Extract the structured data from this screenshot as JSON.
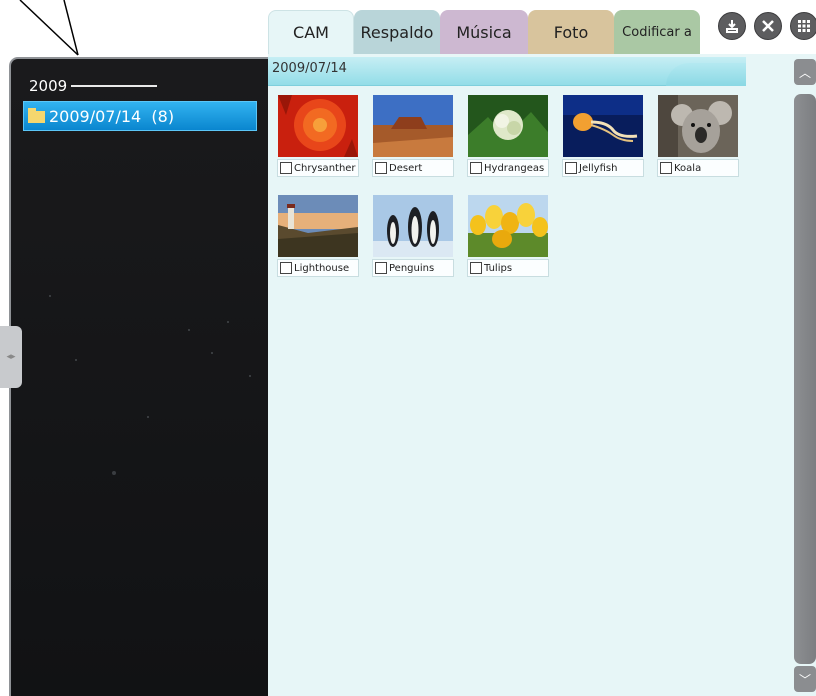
{
  "tree": {
    "year": "2009",
    "date_item": "2009/07/14  (8)"
  },
  "tabs": [
    {
      "label": "CAM"
    },
    {
      "label": "Respaldo"
    },
    {
      "label": "Música"
    },
    {
      "label": "Foto"
    },
    {
      "label": "Codificar a"
    }
  ],
  "toolbar": {
    "icons": [
      "import-icon",
      "close-icon",
      "grid-view-icon"
    ]
  },
  "main": {
    "date_header": "2009/07/14",
    "thumbnails": [
      {
        "label": "Chrysanther"
      },
      {
        "label": "Desert"
      },
      {
        "label": "Hydrangeas"
      },
      {
        "label": "Jellyfish"
      },
      {
        "label": "Koala"
      },
      {
        "label": "Lighthouse"
      },
      {
        "label": "Penguins"
      },
      {
        "label": "Tulips"
      }
    ]
  },
  "colors": {
    "selection": "#0a86cf",
    "panel_bg": "#111214",
    "content_bg": "#e7f6f7"
  }
}
